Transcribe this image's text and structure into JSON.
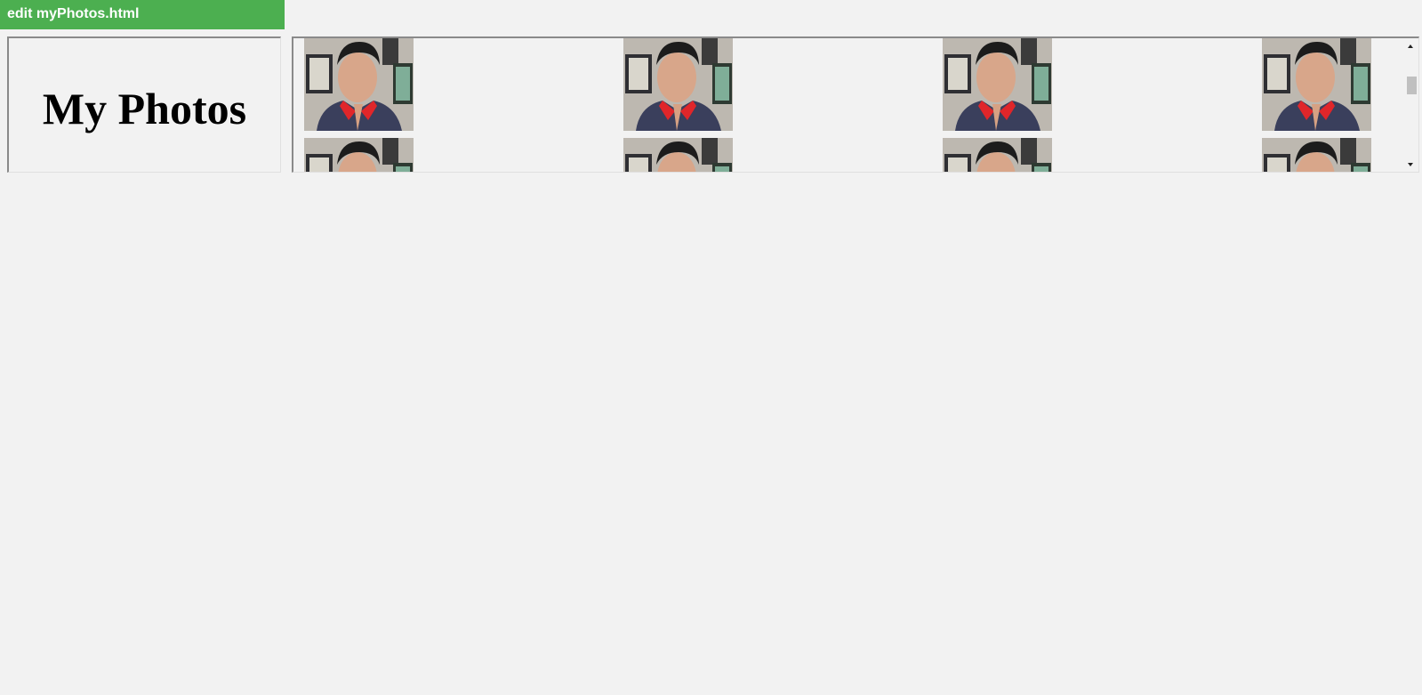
{
  "edit_bar": {
    "label": "edit myPhotos.html",
    "color": "#4caf50"
  },
  "left_frame": {
    "title": "My Photos"
  },
  "gallery": {
    "rows": 2,
    "columns": 4,
    "photo_subject": "portrait-photo"
  },
  "scrollbar": {
    "up_icon": "arrow-up-icon",
    "down_icon": "arrow-down-icon"
  }
}
